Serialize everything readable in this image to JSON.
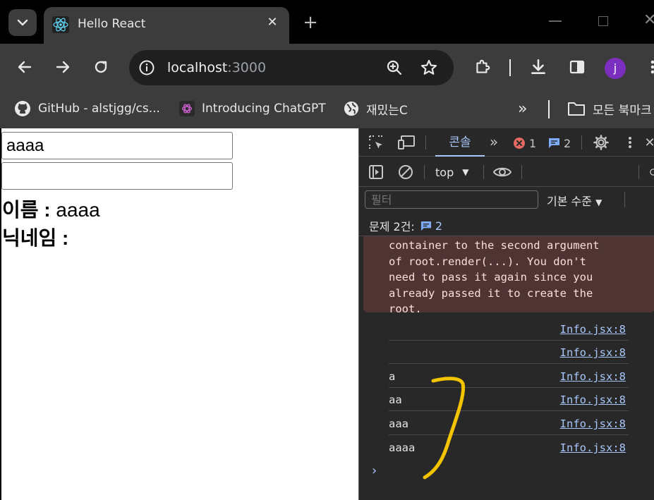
{
  "browser": {
    "tab_title": "Hello React",
    "tab_close": "✕",
    "new_tab": "+",
    "url_host": "localhost",
    "url_port": ":3000",
    "avatar_letter": "j",
    "bookmarks": [
      {
        "label": "GitHub - alstjgg/cs..."
      },
      {
        "label": "Introducing ChatGPT"
      },
      {
        "label": "재밌는C"
      }
    ],
    "bookmarks_overflow": "»",
    "all_bookmarks": "모든 북마크"
  },
  "page": {
    "input1_value": "aaaa",
    "input2_value": "",
    "name_label": "이름 :",
    "name_value": " aaaa",
    "nickname_label": "닉네임 :",
    "nickname_value": ""
  },
  "devtools": {
    "console_tab": "콘솔",
    "more_tabs": "»",
    "error_count": "1",
    "message_count": "2",
    "context": "top",
    "filter_placeholder": "필터",
    "levels": "기본 수준",
    "issues_label": "문제 2건:",
    "issues_count": "2",
    "error_lines": [
      "container to the second argument",
      "of root.render(...). You don't",
      "need to pass it again since you",
      "already passed it to create the",
      "root."
    ],
    "logs": [
      {
        "msg": "",
        "src": "Info.jsx:8"
      },
      {
        "msg": "",
        "src": "Info.jsx:8"
      },
      {
        "msg": "a",
        "src": "Info.jsx:8"
      },
      {
        "msg": "aa",
        "src": "Info.jsx:8"
      },
      {
        "msg": "aaa",
        "src": "Info.jsx:8"
      },
      {
        "msg": "aaaa",
        "src": "Info.jsx:8"
      }
    ],
    "prompt": "›"
  },
  "colors": {
    "annotation": "#f5c400",
    "accent": "#a8c7fa",
    "error_bg": "#4e3534"
  }
}
